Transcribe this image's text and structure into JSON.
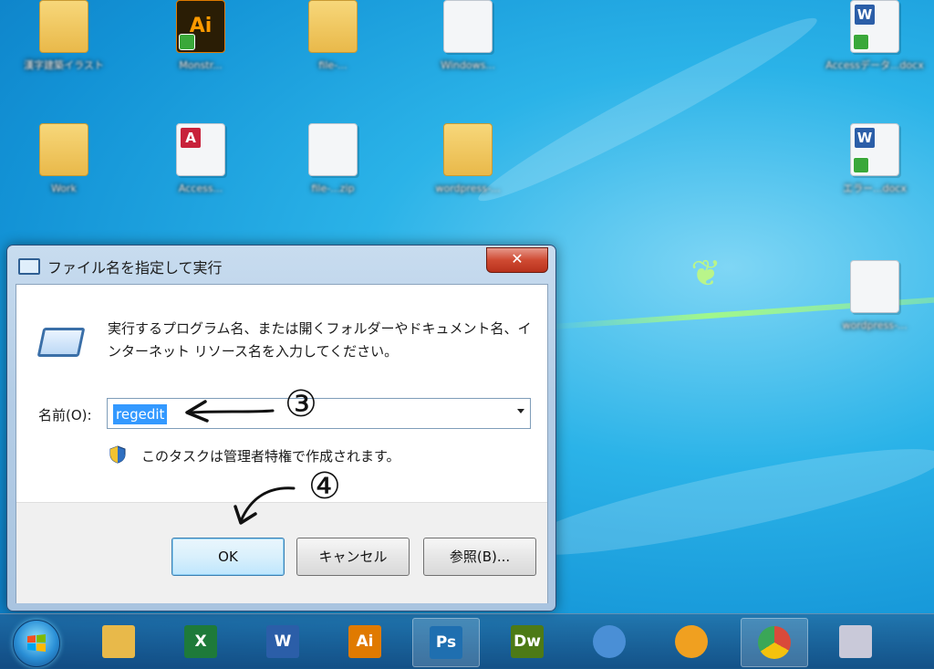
{
  "desktop": {
    "icons": [
      {
        "label": "漢字建築イラスト",
        "kind": "folder"
      },
      {
        "label": "Monstr...",
        "kind": "ai"
      },
      {
        "label": "file-...",
        "kind": "folder"
      },
      {
        "label": "Windows...",
        "kind": "doc"
      },
      {
        "label": "Work",
        "kind": "folder"
      },
      {
        "label": "Access...",
        "kind": "access"
      },
      {
        "label": "file-...zip",
        "kind": "doc"
      },
      {
        "label": "wordpress-...",
        "kind": "folder"
      },
      {
        "label": "Accessデータ...docx",
        "kind": "word"
      },
      {
        "label": "エラー...docx",
        "kind": "word"
      },
      {
        "label": "wordpress-...",
        "kind": "doc"
      }
    ]
  },
  "dialog": {
    "title": "ファイル名を指定して実行",
    "close_label": "✕",
    "description": "実行するプログラム名、または開くフォルダーやドキュメント名、インターネット リソース名を入力してください。",
    "name_label": "名前(O):",
    "input_value": "regedit",
    "admin_note": "このタスクは管理者特権で作成されます。",
    "buttons": {
      "ok": "OK",
      "cancel": "キャンセル",
      "browse": "参照(B)..."
    }
  },
  "annotations": {
    "step3": "③",
    "step4": "④"
  },
  "taskbar": {
    "items": [
      {
        "name": "explorer",
        "label": "",
        "color": "#e8b94a"
      },
      {
        "name": "excel",
        "label": "X",
        "color": "#1e7a3a"
      },
      {
        "name": "word",
        "label": "W",
        "color": "#2b5ea8"
      },
      {
        "name": "illustrator",
        "label": "Ai",
        "color": "#e07a00"
      },
      {
        "name": "photoshop",
        "label": "Ps",
        "color": "#1f6fb0"
      },
      {
        "name": "dreamweaver",
        "label": "Dw",
        "color": "#4d7a16"
      },
      {
        "name": "thunderbird",
        "label": "",
        "color": "#4a8fd6"
      },
      {
        "name": "scratch",
        "label": "",
        "color": "#f0a020"
      },
      {
        "name": "chrome",
        "label": "",
        "color": "#d94a3a"
      },
      {
        "name": "notes",
        "label": "",
        "color": "#c9c9d9"
      }
    ]
  }
}
